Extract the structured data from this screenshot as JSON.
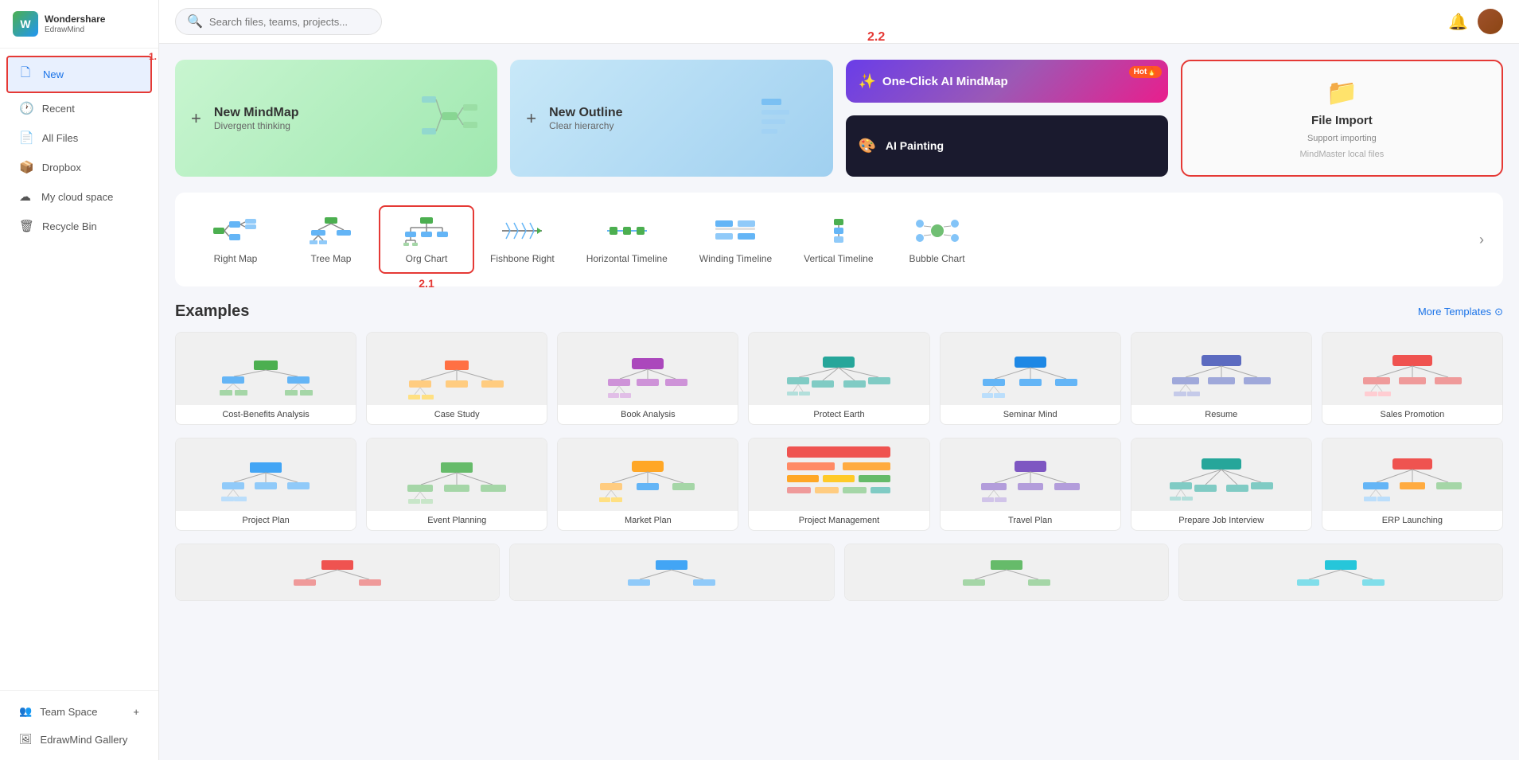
{
  "app": {
    "name": "Wondershare",
    "sub_name": "EdrawMind",
    "logo_letter": "W"
  },
  "header": {
    "search_placeholder": "Search files, teams, projects..."
  },
  "sidebar": {
    "items": [
      {
        "id": "new",
        "label": "New",
        "icon": "🗋",
        "active": true
      },
      {
        "id": "recent",
        "label": "Recent",
        "icon": "🕐"
      },
      {
        "id": "all-files",
        "label": "All Files",
        "icon": "📄"
      },
      {
        "id": "dropbox",
        "label": "Dropbox",
        "icon": "📦"
      },
      {
        "id": "my-cloud",
        "label": "My cloud space",
        "icon": "☁"
      },
      {
        "id": "recycle",
        "label": "Recycle Bin",
        "icon": "🗑"
      }
    ],
    "sections": [
      {
        "id": "team-space",
        "label": "Team Space",
        "has_add": true
      },
      {
        "id": "gallery",
        "label": "EdrawMind Gallery",
        "has_add": false
      }
    ],
    "markers": {
      "new_label": "1.",
      "sidebar_label": "2.2"
    }
  },
  "top_templates": {
    "new_mindmap": {
      "title": "New MindMap",
      "subtitle": "Divergent thinking",
      "icon": "+"
    },
    "new_outline": {
      "title": "New Outline",
      "subtitle": "Clear hierarchy",
      "icon": "+"
    },
    "one_click_ai": {
      "title": "One-Click AI MindMap",
      "badge": "Hot🔥"
    },
    "ai_painting": {
      "title": "AI Painting"
    },
    "file_import": {
      "title": "File Import",
      "subtitle": "Support importing",
      "subtitle2": "MindMaster local files"
    }
  },
  "map_types": [
    {
      "id": "right-map",
      "label": "Right Map"
    },
    {
      "id": "tree-map",
      "label": "Tree Map"
    },
    {
      "id": "org-chart",
      "label": "Org Chart",
      "selected": true
    },
    {
      "id": "fishbone-right",
      "label": "Fishbone Right"
    },
    {
      "id": "horizontal-timeline",
      "label": "Horizontal Timeline"
    },
    {
      "id": "winding-timeline",
      "label": "Winding Timeline"
    },
    {
      "id": "vertical-timeline",
      "label": "Vertical Timeline"
    },
    {
      "id": "bubble-chart",
      "label": "Bubble Chart"
    }
  ],
  "examples": {
    "title": "Examples",
    "more_label": "More Templates",
    "row1": [
      {
        "id": "cost-benefits",
        "label": "Cost-Benefits Analysis"
      },
      {
        "id": "case-study",
        "label": "Case Study"
      },
      {
        "id": "book-analysis",
        "label": "Book Analysis"
      },
      {
        "id": "protect-earth",
        "label": "Protect Earth"
      },
      {
        "id": "seminar-mind",
        "label": "Seminar Mind"
      },
      {
        "id": "resume",
        "label": "Resume"
      },
      {
        "id": "sales-promotion",
        "label": "Sales Promotion"
      }
    ],
    "row2": [
      {
        "id": "project-plan",
        "label": "Project Plan"
      },
      {
        "id": "event-planning",
        "label": "Event Planning"
      },
      {
        "id": "market-plan",
        "label": "Market Plan"
      },
      {
        "id": "project-management",
        "label": "Project Management"
      },
      {
        "id": "travel-plan",
        "label": "Travel Plan"
      },
      {
        "id": "prepare-job-interview",
        "label": "Prepare Job Interview"
      },
      {
        "id": "erp-launching",
        "label": "ERP Launching"
      }
    ],
    "row3": [
      {
        "id": "row3-1",
        "label": ""
      },
      {
        "id": "row3-2",
        "label": ""
      },
      {
        "id": "row3-3",
        "label": ""
      },
      {
        "id": "row3-4",
        "label": ""
      }
    ]
  },
  "labels": {
    "marker_1": "1.",
    "marker_21": "2.1",
    "marker_22": "2.2"
  }
}
